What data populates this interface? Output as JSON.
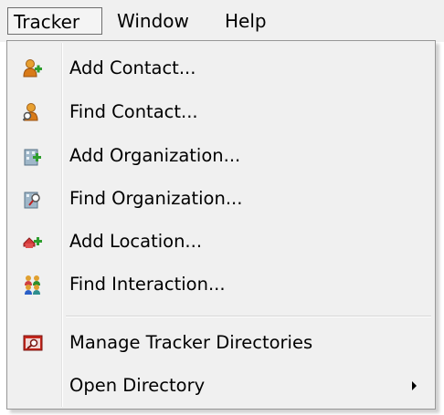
{
  "menubar": {
    "items": [
      {
        "label": "Tracker"
      },
      {
        "label": "Window"
      },
      {
        "label": "Help"
      }
    ]
  },
  "tracker_menu": {
    "items": [
      {
        "label": "Add Contact...",
        "icon": "add-contact-icon"
      },
      {
        "label": "Find Contact...",
        "icon": "find-contact-icon"
      },
      {
        "label": "Add Organization...",
        "icon": "add-organization-icon"
      },
      {
        "label": "Find Organization...",
        "icon": "find-organization-icon"
      },
      {
        "label": "Add Location...",
        "icon": "add-location-icon"
      },
      {
        "label": "Find Interaction...",
        "icon": "find-interaction-icon"
      },
      {
        "label": "Manage Tracker Directories",
        "icon": "manage-directories-icon"
      },
      {
        "label": "Open Directory",
        "icon": "submenu-arrow-icon"
      }
    ]
  },
  "colors": {
    "menu_background": "#f0f0f0",
    "active_border": "#6e6e6e"
  }
}
